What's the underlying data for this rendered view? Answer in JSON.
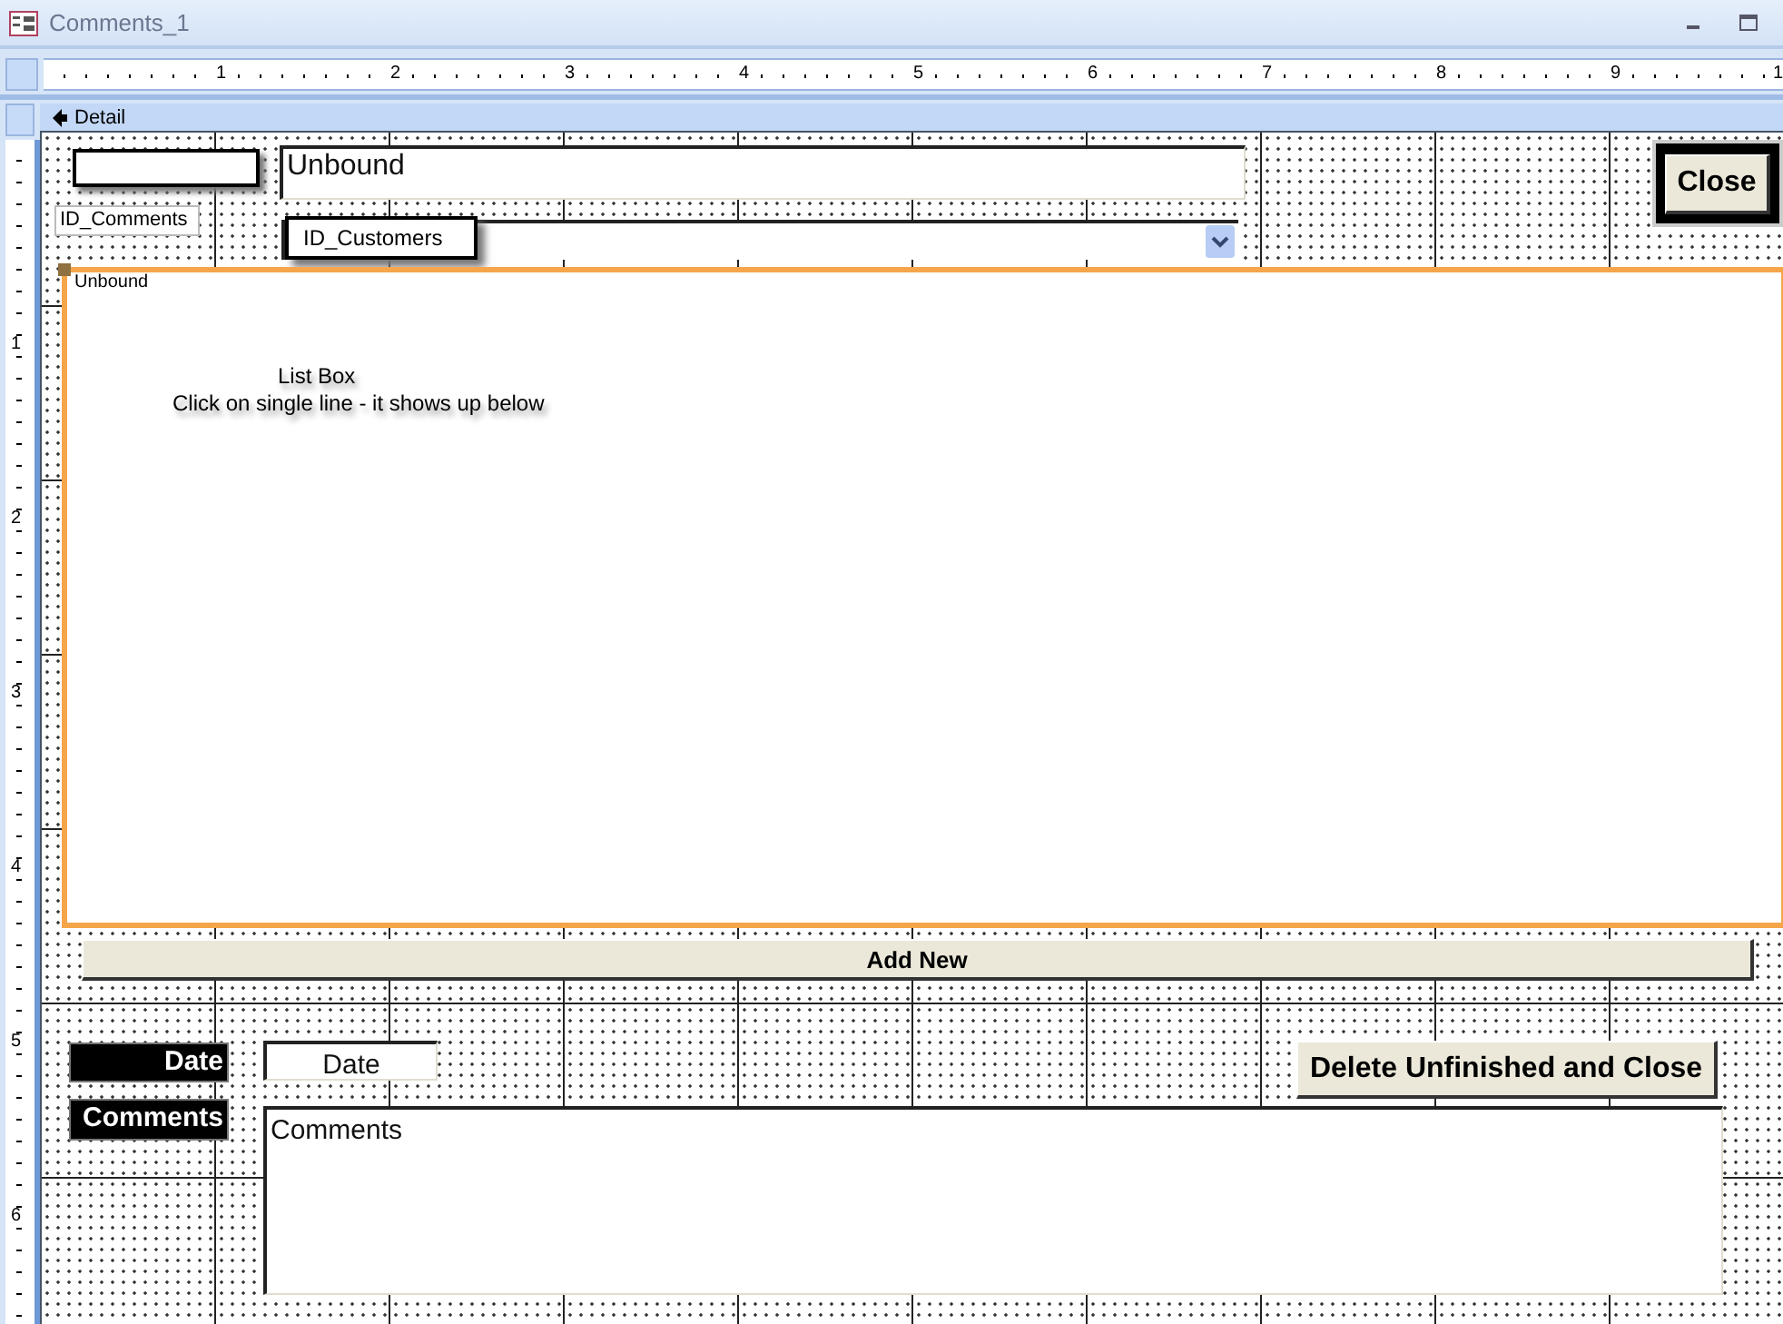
{
  "window": {
    "title": "Comments_1"
  },
  "ruler": {
    "horizontal": [
      "1",
      "2",
      "3",
      "4",
      "5",
      "6",
      "7",
      "8",
      "9",
      "1"
    ],
    "vertical": [
      "1",
      "2",
      "3",
      "4",
      "5",
      "6"
    ]
  },
  "section": {
    "title": "Detail"
  },
  "controls": [
    {
      "kind": "shadowbox",
      "selected": false
    },
    {
      "kind": "textbox",
      "text": "Unbound",
      "selected": false
    },
    {
      "kind": "label",
      "text": "ID_Comments",
      "selected": false
    },
    {
      "kind": "combobox",
      "selected": false
    },
    {
      "kind": "shadowlabel",
      "text": "ID_Customers",
      "selected": false
    },
    {
      "kind": "listbox",
      "text": "Unbound",
      "selected": true
    },
    {
      "kind": "caption",
      "text": "List Box",
      "selected": false
    },
    {
      "kind": "caption",
      "text": "Click on single line - it shows up below",
      "selected": false
    },
    {
      "kind": "framedbutton",
      "text": "Close",
      "selected": false
    },
    {
      "kind": "button",
      "text": "Add New",
      "selected": false
    },
    {
      "kind": "darklabel",
      "text": "Date",
      "selected": false
    },
    {
      "kind": "textbox",
      "text": "Date",
      "selected": false
    },
    {
      "kind": "darklabel",
      "text": "Comments",
      "selected": false
    },
    {
      "kind": "button",
      "text": "Delete Unfinished and Close",
      "selected": false
    },
    {
      "kind": "textbox",
      "text": "Comments",
      "selected": false
    }
  ]
}
